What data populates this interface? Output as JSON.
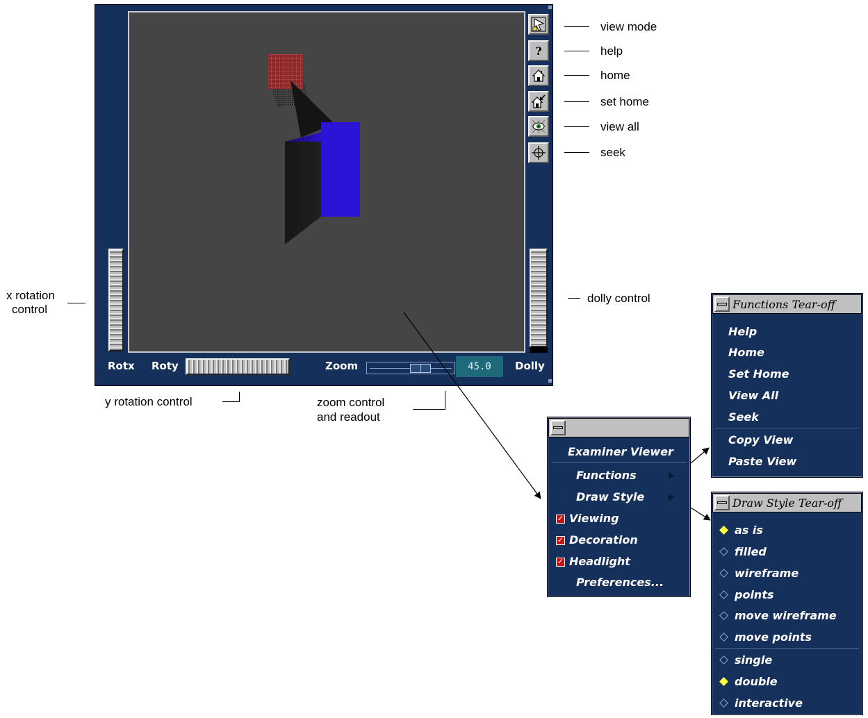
{
  "viewer": {
    "labels": {
      "rotx": "Rotx",
      "roty": "Roty",
      "zoom": "Zoom",
      "dolly": "Dolly"
    },
    "zoom_value": "45.0",
    "buttons": [
      {
        "name": "view-mode-button",
        "icon": "arrow-pointer-icon"
      },
      {
        "name": "help-button",
        "icon": "question-mark-icon"
      },
      {
        "name": "home-button",
        "icon": "house-icon"
      },
      {
        "name": "set-home-button",
        "icon": "house-arrow-icon"
      },
      {
        "name": "view-all-button",
        "icon": "eye-icon"
      },
      {
        "name": "seek-button",
        "icon": "crosshair-icon"
      }
    ],
    "colors": {
      "frame": "#15305a",
      "viewport": "#454545",
      "box_blue": "#2a10d0",
      "grid_red": "#a02828"
    }
  },
  "callouts": {
    "view_mode": "view mode",
    "help": "help",
    "home": "home",
    "set_home": "set home",
    "view_all": "view all",
    "seek": "seek",
    "x_rotation_1": "x rotation",
    "x_rotation_2": "control",
    "dolly_control": "dolly control",
    "y_rotation": "y rotation control",
    "zoom_control_1": "zoom control",
    "zoom_control_2": "and readout"
  },
  "popup_menu": {
    "title": "Examiner Viewer",
    "items": [
      "Functions",
      "Draw Style"
    ],
    "toggles": [
      {
        "label": "Viewing",
        "checked": true
      },
      {
        "label": "Decoration",
        "checked": true
      },
      {
        "label": "Headlight",
        "checked": true
      }
    ],
    "preferences": "Preferences..."
  },
  "functions_menu": {
    "title": "Functions Tear-off",
    "group1": [
      "Help",
      "Home",
      "Set Home",
      "View All",
      "Seek"
    ],
    "group2": [
      "Copy View",
      "Paste View"
    ]
  },
  "draw_style_menu": {
    "title": "Draw Style Tear-off",
    "group1": [
      {
        "label": "as is",
        "selected": true
      },
      {
        "label": "filled",
        "selected": false
      },
      {
        "label": "wireframe",
        "selected": false
      },
      {
        "label": "points",
        "selected": false
      },
      {
        "label": "move wireframe",
        "selected": false
      },
      {
        "label": "move points",
        "selected": false
      }
    ],
    "group2": [
      {
        "label": "single",
        "selected": false
      },
      {
        "label": "double",
        "selected": true
      },
      {
        "label": "interactive",
        "selected": false
      }
    ]
  }
}
